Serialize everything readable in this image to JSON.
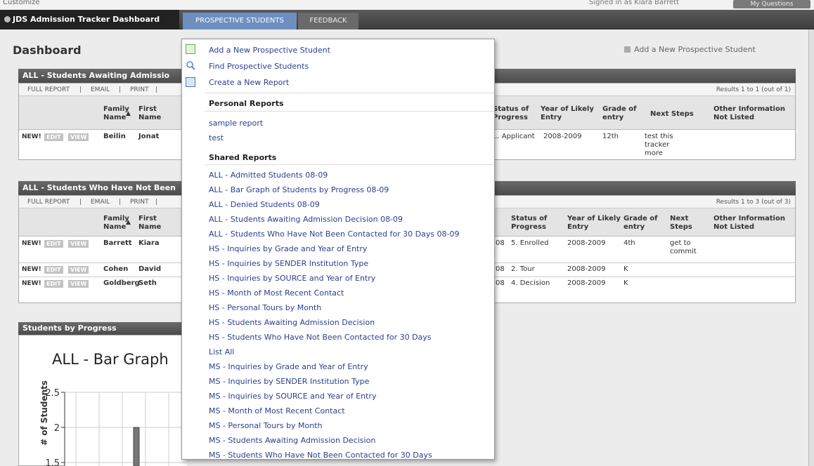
{
  "topbar": {
    "left_text": "Customize",
    "signed_in_text": "Signed in as Kiara Barrett",
    "button_label": "My Questions"
  },
  "nav": {
    "brand": "JDS Admission Tracker Dashboard",
    "tabs": [
      {
        "label": "PROSPECTIVE STUDENTS",
        "active": true
      },
      {
        "label": "FEEDBACK",
        "active": false
      }
    ]
  },
  "page": {
    "title": "Dashboard",
    "add_link": "Add a New Prospective Student"
  },
  "panel1": {
    "title": "ALL - Students Awaiting Admissio",
    "toolbar": [
      "FULL REPORT",
      "|",
      "EMAIL",
      "|",
      "PRINT",
      "|"
    ],
    "results": "Results 1 to 1 (out of 1)",
    "columns": [
      "Family Name",
      "First Name",
      "Status of Progress",
      "Year of Likely Entry",
      "Grade of entry",
      "Next Steps",
      "Other Information Not Listed"
    ],
    "sort_arrow": "▲",
    "rows": [
      {
        "new": "NEW!",
        "edit": "EDIT",
        "view": "VIEW",
        "family": "Beilin",
        "first": "Jonat",
        "status": "... Applicant",
        "year": "2008-2009",
        "grade": "12th",
        "next": "test this tracker more",
        "other": ""
      }
    ]
  },
  "panel2": {
    "title": "ALL - Students Who Have Not Been",
    "toolbar": [
      "FULL REPORT",
      "|",
      "EMAIL",
      "|",
      "PRINT",
      "|"
    ],
    "results": "Results 1 to 3 (out of 3)",
    "columns": [
      "Family Name",
      "First Name",
      "Status of Progress",
      "Year of Likely Entry",
      "Grade of entry",
      "Next Steps",
      "Other Information Not Listed"
    ],
    "sort_arrow": "▲",
    "rows": [
      {
        "new": "NEW!",
        "edit": "EDIT",
        "view": "VIEW",
        "family": "Barrett",
        "first": "Kiara",
        "date": "08",
        "status": "5. Enrolled",
        "year": "2008-2009",
        "grade": "4th",
        "next": "get to commit",
        "other": ""
      },
      {
        "new": "NEW!",
        "edit": "EDIT",
        "view": "VIEW",
        "family": "Cohen",
        "first": "David",
        "date": "08",
        "status": "2. Tour",
        "year": "2008-2009",
        "grade": "K",
        "next": "",
        "other": ""
      },
      {
        "new": "NEW!",
        "edit": "EDIT",
        "view": "VIEW",
        "family": "Goldberg",
        "first": "Seth",
        "date": "08",
        "status": "4. Decision",
        "year": "2008-2009",
        "grade": "K",
        "next": "",
        "other": ""
      }
    ]
  },
  "chart_panel": {
    "title": "Students by Progress"
  },
  "chart_data": {
    "type": "bar",
    "title": "ALL - Bar Graph",
    "ylabel": "# of Students",
    "ylim": [
      1.5,
      2.5
    ],
    "yticks": [
      "2.5",
      "2",
      "1.5"
    ],
    "categories": [
      ""
    ],
    "values": [
      2
    ]
  },
  "dropdown": {
    "actions": [
      {
        "label": "Add a New Prospective Student",
        "icon": "add-student-icon"
      },
      {
        "label": "Find Prospective Students",
        "icon": "magnifier-icon"
      },
      {
        "label": "Create a New Report",
        "icon": "report-icon"
      }
    ],
    "personal_title": "Personal Reports",
    "personal": [
      "sample report",
      "test"
    ],
    "shared_title": "Shared Reports",
    "shared": [
      "ALL - Admitted Students 08-09",
      "ALL - Bar Graph of Students by Progress 08-09",
      "ALL - Denied Students 08-09",
      "ALL - Students Awaiting Admission Decision 08-09",
      "ALL - Students Who Have Not Been Contacted for 30 Days 08-09",
      "HS - Inquiries by Grade and Year of Entry",
      "HS - Inquiries by SENDER Institution Type",
      "HS - Inquiries by SOURCE and Year of Entry",
      "HS - Month of Most Recent Contact",
      "HS - Personal Tours by Month",
      "HS - Students Awaiting Admission Decision",
      "HS - Students Who Have Not Been Contacted for 30 Days",
      "List All",
      "MS - Inquiries by Grade and Year of Entry",
      "MS - Inquiries by SENDER Institution Type",
      "MS - Inquiries by SOURCE and Year of Entry",
      "MS - Month of Most Recent Contact",
      "MS - Personal Tours by Month",
      "MS - Students Awaiting Admission Decision",
      "MS - Students Who Have Not Been Contacted for 30 Days"
    ]
  },
  "colors": {
    "active_tab": "#6d8fc0",
    "link": "#2b3f8f",
    "panel_header": "#555555"
  }
}
